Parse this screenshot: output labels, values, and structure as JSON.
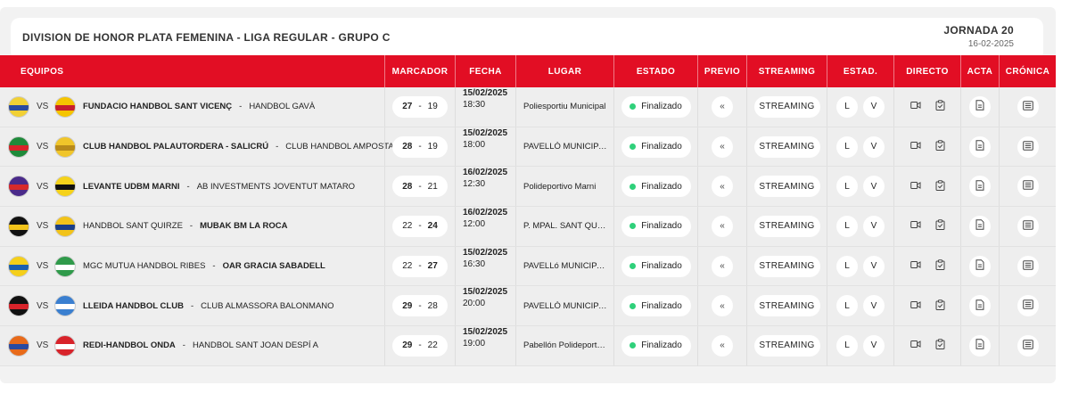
{
  "header": {
    "competition": "DIVISION DE HONOR PLATA FEMENINA - LIGA REGULAR - GRUPO C",
    "jornada": "JORNADA 20",
    "jornada_date": "16-02-2025"
  },
  "columns": [
    "EQUIPOS",
    "MARCADOR",
    "FECHA",
    "LUGAR",
    "ESTADO",
    "PREVIO",
    "STREAMING",
    "ESTAD.",
    "DIRECTO",
    "ACTA",
    "CRÓNICA"
  ],
  "labels": {
    "vs": "VS",
    "team_sep": "-",
    "score_sep": "-",
    "estad_l": "L",
    "estad_v": "V",
    "previo_glyph": "«"
  },
  "matches": [
    {
      "home": "FUNDACIO HANDBOL SANT VICENÇ",
      "away": "HANDBOL GAVÀ",
      "home_score": "27",
      "away_score": "19",
      "winner": "home",
      "date": "15/02/2025",
      "time": "18:30",
      "venue": "Poliesportiu Municipal",
      "status": "Finalizado",
      "streaming": "STREAMING",
      "home_crest": [
        "#f1d035",
        "#2a4aa0"
      ],
      "away_crest": [
        "#f5c400",
        "#c61d2e"
      ]
    },
    {
      "home": "CLUB HANDBOL PALAUTORDERA - SALICRÚ",
      "away": "CLUB HANDBOL AMPOSTA",
      "home_score": "28",
      "away_score": "19",
      "winner": "home",
      "date": "15/02/2025",
      "time": "18:00",
      "venue": "PAVELLÓ MUNICIPAL DE",
      "status": "Finalizado",
      "streaming": "STREAMING",
      "home_crest": [
        "#1f8a3a",
        "#d8232a"
      ],
      "away_crest": [
        "#f0c52a",
        "#b88a1b"
      ]
    },
    {
      "home": "LEVANTE UDBM MARNI",
      "away": "AB INVESTMENTS JOVENTUT MATARO",
      "home_score": "28",
      "away_score": "21",
      "winner": "home",
      "date": "16/02/2025",
      "time": "12:30",
      "venue": "Polideportivo Marni",
      "status": "Finalizado",
      "streaming": "STREAMING",
      "home_crest": [
        "#4a2a8a",
        "#d82a2a"
      ],
      "away_crest": [
        "#f5d21a",
        "#111111"
      ]
    },
    {
      "home": "HANDBOL SANT QUIRZE",
      "away": "MUBAK BM LA ROCA",
      "home_score": "22",
      "away_score": "24",
      "winner": "away",
      "date": "16/02/2025",
      "time": "12:00",
      "venue": "P. MPAL. SANT QUIRZE",
      "status": "Finalizado",
      "streaming": "STREAMING",
      "home_crest": [
        "#111111",
        "#f2c31a"
      ],
      "away_crest": [
        "#f2c31a",
        "#1a3f8a"
      ]
    },
    {
      "home": "MGC MUTUA HANDBOL RIBES",
      "away": "OAR GRACIA SABADELL",
      "home_score": "22",
      "away_score": "27",
      "winner": "away",
      "date": "15/02/2025",
      "time": "16:30",
      "venue": "PAVELLó MUNICIPAL DE",
      "status": "Finalizado",
      "streaming": "STREAMING",
      "home_crest": [
        "#f5cf1a",
        "#1b5fb0"
      ],
      "away_crest": [
        "#2f9a4a",
        "#ffffff"
      ]
    },
    {
      "home": "LLEIDA HANDBOL CLUB",
      "away": "CLUB ALMASSORA BALONMANO",
      "home_score": "29",
      "away_score": "28",
      "winner": "home",
      "date": "15/02/2025",
      "time": "20:00",
      "venue": "PAVELLÓ MUNICIPAL DE",
      "status": "Finalizado",
      "streaming": "STREAMING",
      "home_crest": [
        "#111111",
        "#d8232a"
      ],
      "away_crest": [
        "#3a7fd0",
        "#ffffff"
      ]
    },
    {
      "home": "REDI-HANDBOL ONDA",
      "away": "HANDBOL SANT JOAN DESPÍ A",
      "home_score": "29",
      "away_score": "22",
      "winner": "home",
      "date": "15/02/2025",
      "time": "19:00",
      "venue": "Pabellón Polideportivo",
      "status": "Finalizado",
      "streaming": "STREAMING",
      "home_crest": [
        "#e86a1a",
        "#2a4aa0"
      ],
      "away_crest": [
        "#d8232a",
        "#ffffff"
      ]
    }
  ]
}
